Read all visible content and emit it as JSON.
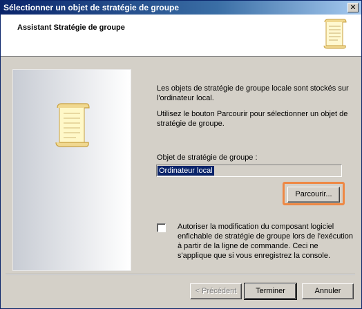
{
  "window": {
    "title": "Sélectionner un objet de stratégie de groupe",
    "close_glyph": "✕"
  },
  "header": {
    "title": "Assistant Stratégie de groupe",
    "icon": "scroll-icon"
  },
  "main": {
    "paragraph1": "Les objets de stratégie de groupe locale sont stockés sur l'ordinateur local.",
    "paragraph2": "Utilisez le bouton Parcourir pour sélectionner un objet de stratégie de groupe.",
    "gpo_label": "Objet de stratégie de groupe :",
    "gpo_value": "Ordinateur local",
    "browse_label": "Parcourir...",
    "checkbox_checked": false,
    "checkbox_label": "Autoriser la modification du composant logiciel enfichable de stratégie de groupe lors de l'exécution à partir de la ligne de commande. Ceci ne s'applique que si vous enregistrez la console."
  },
  "footer": {
    "prev_label": "< Précédent",
    "finish_label": "Terminer",
    "cancel_label": "Annuler"
  },
  "colors": {
    "title_bar": "#0a246a",
    "highlight": "#ee8844",
    "face": "#d4d0c8"
  }
}
